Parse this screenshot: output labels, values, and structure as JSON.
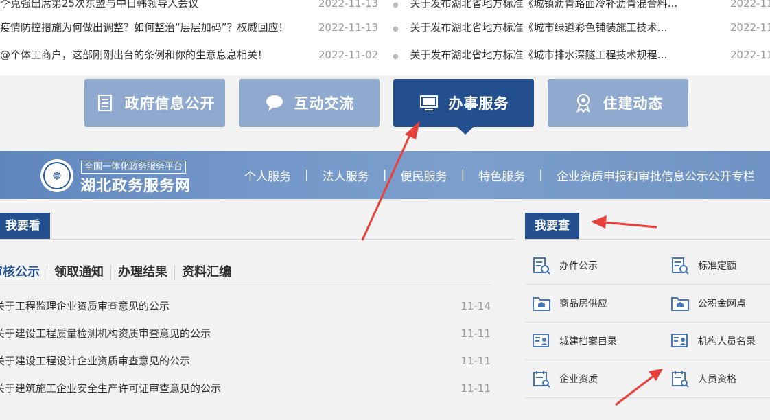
{
  "news": {
    "left": [
      {
        "title": "李克强出席第25次东盟与中日韩领导人会议",
        "date": "2022-11-13"
      },
      {
        "title": "疫情防控措施为何做出调整？如何整治“层层加码”？权威回应！",
        "date": "2022-11-13"
      },
      {
        "title": "@个体工商户，这部刚刚出台的条例和你的生意息息相关！",
        "date": "2022-11-02"
      }
    ],
    "right": [
      {
        "title": "关于发布湖北省地方标准《城镇沥青路面冷补沥青混合料…",
        "date": "2022-11"
      },
      {
        "title": "关于发布湖北省地方标准《城市绿道彩色铺装施工技术…",
        "date": "2022-11"
      },
      {
        "title": "关于发布湖北省地方标准《城市排水深隧工程技术规程…",
        "date": "2022-11"
      }
    ]
  },
  "tabs": [
    {
      "label": "政府信息公开",
      "icon": "document-list-icon"
    },
    {
      "label": "互动交流",
      "icon": "chat-bubble-icon"
    },
    {
      "label": "办事服务",
      "icon": "monitor-icon",
      "active": true
    },
    {
      "label": "住建动态",
      "icon": "award-badge-icon"
    }
  ],
  "banner": {
    "platform_tag": "全国一体化政务服务平台",
    "platform_name": "湖北政务服务网",
    "nav": [
      "个人服务",
      "法人服务",
      "便民服务",
      "特色服务",
      "企业资质申报和审批信息公示公开专栏"
    ],
    "separator": "|"
  },
  "left_panel": {
    "title": "我要看",
    "subtabs": [
      "审核公示",
      "领取通知",
      "办理结果",
      "资料汇编"
    ],
    "notices": [
      {
        "title": "关于工程监理企业资质审查意见的公示",
        "date": "11-14"
      },
      {
        "title": "关于建设工程质量检测机构资质审查意见的公示",
        "date": "11-11"
      },
      {
        "title": "关于建设工程设计企业资质审查意见的公示",
        "date": "11-11"
      },
      {
        "title": "关于建筑施工企业安全生产许可证审查意见的公示",
        "date": "11-11"
      }
    ]
  },
  "right_panel": {
    "title": "我要查",
    "items": [
      {
        "label": "办件公示",
        "icon": "doc-search-icon"
      },
      {
        "label": "标准定额",
        "icon": "doc-search-icon"
      },
      {
        "label": "商品房供应",
        "icon": "folder-building-icon"
      },
      {
        "label": "公积金网点",
        "icon": "folder-building-icon"
      },
      {
        "label": "城建档案目录",
        "icon": "id-card-icon"
      },
      {
        "label": "机构人员名录",
        "icon": "id-card-icon"
      },
      {
        "label": "企业资质",
        "icon": "calendar-search-icon"
      },
      {
        "label": "人员资格",
        "icon": "calendar-search-icon"
      }
    ]
  },
  "colors": {
    "primary": "#244f8e",
    "tab_inactive": "#8fa9cf",
    "annotation_arrow": "#e8403a"
  }
}
